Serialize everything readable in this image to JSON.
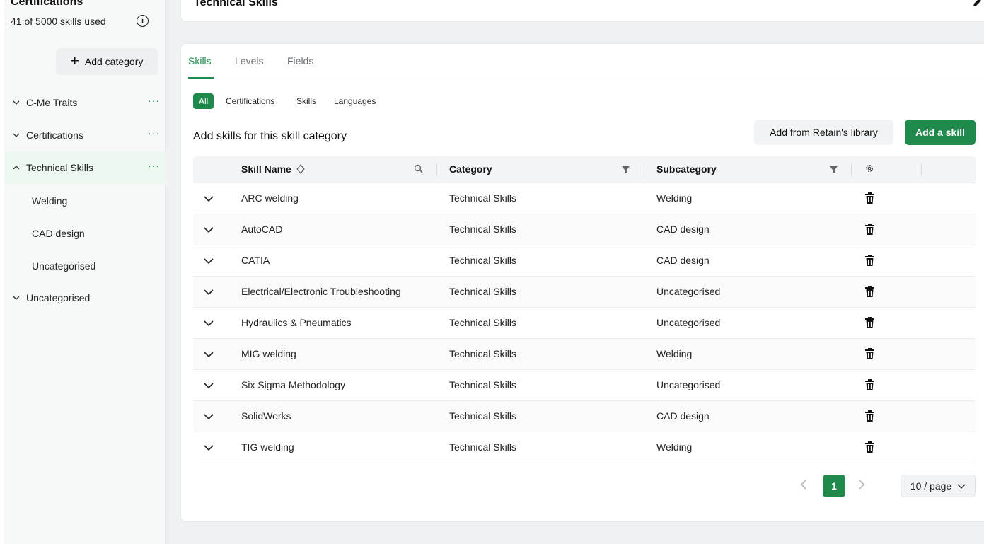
{
  "sidebar": {
    "title": "Certifications",
    "usage": "41 of 5000 skills used",
    "info_icon": "i",
    "add_category_label": "Add category",
    "categories": [
      {
        "label": "C-Me Traits",
        "menu": "···"
      },
      {
        "label": "Certifications",
        "menu": "···"
      },
      {
        "label": "Technical Skills",
        "menu": "···"
      },
      {
        "label": "Uncategorised"
      }
    ],
    "subcategories": [
      "Welding",
      "CAD design",
      "Uncategorised"
    ]
  },
  "header": {
    "title": "Technical Skills"
  },
  "tabs": [
    "Skills",
    "Levels",
    "Fields"
  ],
  "filters": [
    "All",
    "Certifications",
    "Skills",
    "Languages"
  ],
  "section": {
    "title": "Add skills for this skill category",
    "library_button": "Add from Retain's library",
    "add_button": "Add a skill"
  },
  "table": {
    "columns": {
      "name": "Skill Name",
      "category": "Category",
      "subcategory": "Subcategory"
    },
    "rows": [
      {
        "name": "ARC welding",
        "category": "Technical Skills",
        "subcategory": "Welding"
      },
      {
        "name": "AutoCAD",
        "category": "Technical Skills",
        "subcategory": "CAD design"
      },
      {
        "name": "CATIA",
        "category": "Technical Skills",
        "subcategory": "CAD design"
      },
      {
        "name": "Electrical/Electronic Troubleshooting",
        "category": "Technical Skills",
        "subcategory": "Uncategorised"
      },
      {
        "name": "Hydraulics & Pneumatics",
        "category": "Technical Skills",
        "subcategory": "Uncategorised"
      },
      {
        "name": "MIG welding",
        "category": "Technical Skills",
        "subcategory": "Welding"
      },
      {
        "name": "Six Sigma Methodology",
        "category": "Technical Skills",
        "subcategory": "Uncategorised"
      },
      {
        "name": "SolidWorks",
        "category": "Technical Skills",
        "subcategory": "CAD design"
      },
      {
        "name": "TIG welding",
        "category": "Technical Skills",
        "subcategory": "Welding"
      }
    ]
  },
  "pagination": {
    "current": "1",
    "page_size": "10 / page"
  },
  "colors": {
    "accent": "#1f8a4c",
    "active_bg": "#edf8f1"
  }
}
